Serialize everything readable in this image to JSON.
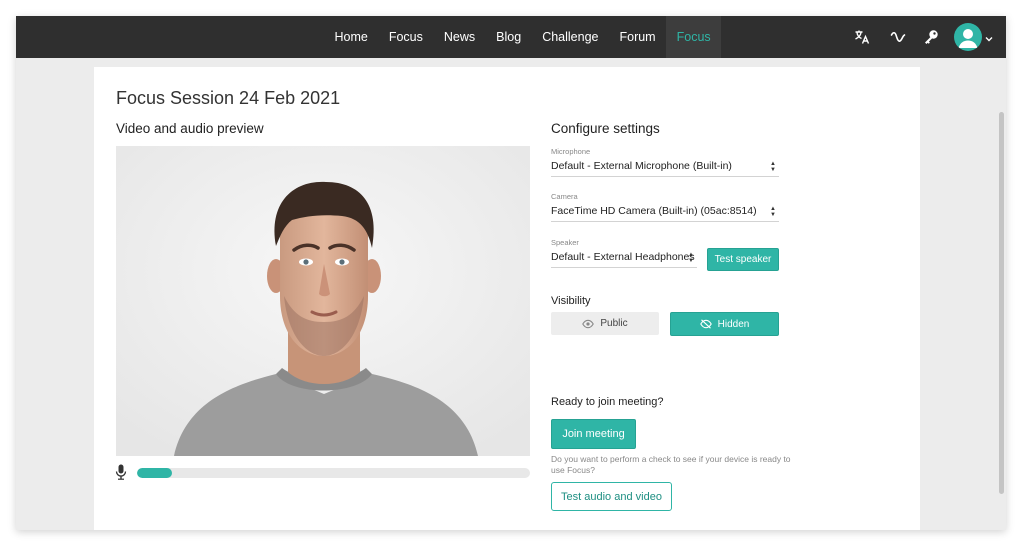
{
  "nav": {
    "links": [
      "Home",
      "Focus",
      "News",
      "Blog",
      "Challenge",
      "Forum",
      "Focus"
    ],
    "active_index": 6,
    "icons": [
      "translate-icon",
      "activity-wave-icon",
      "key-icon",
      "user-avatar-icon",
      "chevron-down-icon"
    ]
  },
  "page": {
    "title": "Focus Session 24 Feb 2021"
  },
  "preview": {
    "heading": "Video and audio preview",
    "audio_level": 0.09
  },
  "settings": {
    "heading": "Configure settings",
    "microphone": {
      "label": "Microphone",
      "value": "Default - External Microphone (Built-in)"
    },
    "camera": {
      "label": "Camera",
      "value": "FaceTime HD Camera (Built-in) (05ac:8514)"
    },
    "speaker": {
      "label": "Speaker",
      "value": "Default - External Headphones",
      "test_label": "Test speaker"
    },
    "visibility": {
      "label": "Visibility",
      "public_label": "Public",
      "hidden_label": "Hidden",
      "selected": "Hidden"
    }
  },
  "join": {
    "question": "Ready to join meeting?",
    "button_label": "Join meeting",
    "check_hint": "Do you want to perform a check to see if your device is ready to use Focus?",
    "check_button_label": "Test audio and video"
  },
  "colors": {
    "accent": "#2fb5a6",
    "navbar": "#2f2f2f"
  }
}
